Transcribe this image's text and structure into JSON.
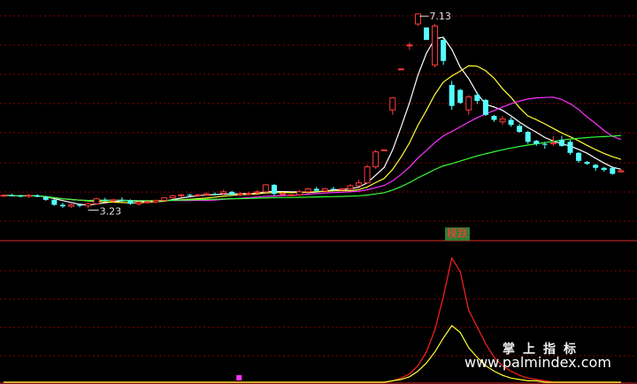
{
  "chart_data": [
    {
      "type": "candlestick",
      "title": "",
      "price_range": [
        2.6,
        7.4
      ],
      "labels": {
        "high": "7.13",
        "low": "3.23"
      },
      "colors": {
        "up": "#ff3b3b",
        "down": "#54ffff",
        "ma_short": "#ffffff",
        "ma_mid": "#ffff33",
        "ma_long": "#ff33ff",
        "ma_longest": "#33ff33",
        "grid": "#8b0000"
      },
      "candles": [
        [
          3.49,
          3.51,
          3.46,
          3.49
        ],
        [
          3.49,
          3.52,
          3.47,
          3.48
        ],
        [
          3.48,
          3.5,
          3.45,
          3.47
        ],
        [
          3.47,
          3.52,
          3.44,
          3.49
        ],
        [
          3.49,
          3.51,
          3.45,
          3.46
        ],
        [
          3.46,
          3.48,
          3.38,
          3.4
        ],
        [
          3.4,
          3.42,
          3.28,
          3.3
        ],
        [
          3.3,
          3.34,
          3.24,
          3.27
        ],
        [
          3.27,
          3.32,
          3.24,
          3.3
        ],
        [
          3.3,
          3.32,
          3.25,
          3.28
        ],
        [
          3.28,
          3.34,
          3.23,
          3.32
        ],
        [
          3.32,
          3.44,
          3.3,
          3.42
        ],
        [
          3.4,
          3.44,
          3.36,
          3.38
        ],
        [
          3.38,
          3.42,
          3.34,
          3.4
        ],
        [
          3.4,
          3.45,
          3.36,
          3.39
        ],
        [
          3.39,
          3.41,
          3.3,
          3.32
        ],
        [
          3.32,
          3.38,
          3.28,
          3.35
        ],
        [
          3.35,
          3.38,
          3.32,
          3.36
        ],
        [
          3.36,
          3.4,
          3.33,
          3.39
        ],
        [
          3.39,
          3.45,
          3.37,
          3.44
        ],
        [
          3.44,
          3.5,
          3.42,
          3.48
        ],
        [
          3.48,
          3.52,
          3.45,
          3.5
        ],
        [
          3.5,
          3.52,
          3.47,
          3.49
        ],
        [
          3.49,
          3.52,
          3.46,
          3.5
        ],
        [
          3.5,
          3.55,
          3.48,
          3.52
        ],
        [
          3.52,
          3.55,
          3.49,
          3.51
        ],
        [
          3.53,
          3.6,
          3.5,
          3.56
        ],
        [
          3.56,
          3.58,
          3.48,
          3.5
        ],
        [
          3.5,
          3.55,
          3.48,
          3.52
        ],
        [
          3.52,
          3.56,
          3.49,
          3.53
        ],
        [
          3.54,
          3.6,
          3.5,
          3.56
        ],
        [
          3.56,
          3.72,
          3.54,
          3.7
        ],
        [
          3.7,
          3.72,
          3.48,
          3.52
        ],
        [
          3.52,
          3.56,
          3.48,
          3.52
        ],
        [
          3.5,
          3.52,
          3.48,
          3.5
        ],
        [
          3.5,
          3.6,
          3.48,
          3.56
        ],
        [
          3.56,
          3.64,
          3.54,
          3.62
        ],
        [
          3.62,
          3.66,
          3.56,
          3.58
        ],
        [
          3.58,
          3.64,
          3.56,
          3.62
        ],
        [
          3.62,
          3.66,
          3.58,
          3.6
        ],
        [
          3.6,
          3.64,
          3.58,
          3.62
        ],
        [
          3.62,
          3.72,
          3.6,
          3.68
        ],
        [
          3.68,
          3.8,
          3.66,
          3.74
        ],
        [
          3.74,
          4.1,
          3.72,
          4.06
        ],
        [
          4.06,
          4.4,
          4.02,
          4.36
        ],
        [
          4.4,
          4.4,
          4.4,
          4.4
        ],
        [
          5.2,
          5.46,
          5.1,
          5.44
        ],
        [
          6.02,
          6.02,
          6.02,
          6.02
        ],
        [
          6.5,
          6.55,
          6.4,
          6.5
        ],
        [
          6.92,
          7.13,
          6.88,
          7.12
        ],
        [
          6.85,
          6.85,
          6.6,
          6.6
        ],
        [
          6.1,
          6.92,
          6.05,
          6.88
        ],
        [
          6.6,
          6.65,
          6.1,
          6.18
        ],
        [
          5.7,
          5.78,
          5.2,
          5.28
        ],
        [
          5.6,
          5.62,
          5.32,
          5.34
        ],
        [
          5.2,
          5.5,
          5.1,
          5.46
        ],
        [
          5.5,
          5.56,
          5.32,
          5.38
        ],
        [
          5.4,
          5.42,
          5.08,
          5.1
        ],
        [
          5.08,
          5.1,
          4.96,
          5.0
        ],
        [
          4.96,
          5.08,
          4.9,
          5.02
        ],
        [
          5.0,
          5.05,
          4.86,
          4.9
        ],
        [
          4.88,
          4.92,
          4.74,
          4.76
        ],
        [
          4.76,
          4.78,
          4.52,
          4.56
        ],
        [
          4.58,
          4.6,
          4.48,
          4.52
        ],
        [
          4.52,
          4.56,
          4.42,
          4.5
        ],
        [
          4.52,
          4.68,
          4.48,
          4.54
        ],
        [
          4.6,
          4.68,
          4.46,
          4.48
        ],
        [
          4.56,
          4.6,
          4.3,
          4.34
        ],
        [
          4.34,
          4.36,
          4.14,
          4.18
        ],
        [
          4.16,
          4.18,
          4.1,
          4.12
        ],
        [
          4.1,
          4.12,
          3.98,
          4.04
        ],
        [
          4.04,
          4.06,
          3.96,
          4.0
        ],
        [
          4.04,
          4.06,
          3.9,
          3.92
        ],
        [
          3.96,
          4.02,
          3.94,
          3.98
        ]
      ]
    },
    {
      "type": "line",
      "title": "",
      "badge": "模跌",
      "ylim": [
        0,
        100
      ],
      "series": [
        {
          "color": "#ff2020",
          "values": [
            0,
            0,
            0,
            0,
            0,
            0,
            0,
            0,
            0,
            0,
            0,
            0,
            0,
            0,
            0,
            0,
            0,
            0,
            0,
            0,
            0,
            0,
            0,
            0,
            0,
            0,
            0,
            0,
            0,
            0,
            0,
            0,
            0,
            0,
            0,
            0,
            0,
            0,
            0,
            0,
            0,
            0,
            0,
            0,
            0,
            0,
            1,
            3,
            6,
            12,
            22,
            38,
            62,
            90,
            80,
            52,
            40,
            28,
            18,
            12,
            8,
            5,
            3,
            2,
            1,
            0,
            0,
            0,
            0,
            0,
            0,
            0,
            0,
            0
          ]
        },
        {
          "color": "#ffff33",
          "values": [
            0,
            0,
            0,
            0,
            0,
            0,
            0,
            0,
            0,
            0,
            0,
            0,
            0,
            0,
            0,
            0,
            0,
            0,
            0,
            0,
            0,
            0,
            0,
            0,
            0,
            0,
            0,
            0,
            0,
            0,
            0,
            0,
            0,
            0,
            0,
            0,
            0,
            0,
            0,
            0,
            0,
            0,
            0,
            0,
            0,
            0,
            1,
            2,
            4,
            8,
            14,
            22,
            32,
            41,
            36,
            25,
            18,
            12,
            8,
            5,
            3,
            2,
            1,
            1,
            0,
            0,
            0,
            0,
            0,
            0,
            0,
            0,
            0,
            0
          ]
        }
      ],
      "marker_index": 29,
      "marker_color": "#ff33ff"
    }
  ],
  "watermark": {
    "line1": "掌上指标",
    "line2": "www.palmindex.com"
  }
}
